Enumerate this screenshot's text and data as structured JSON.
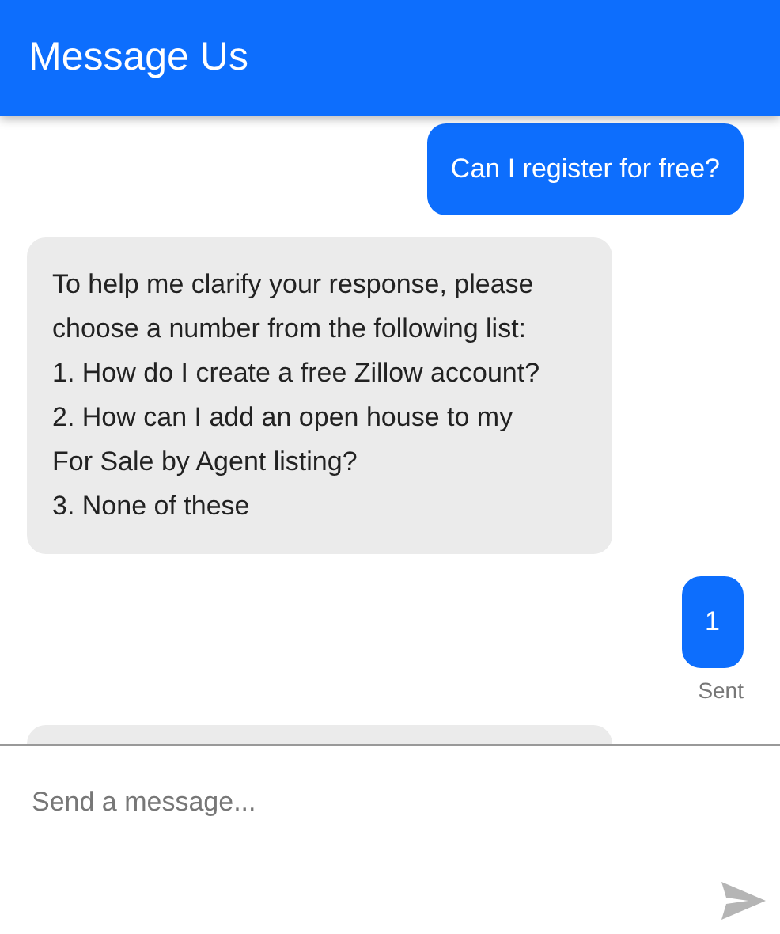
{
  "header": {
    "title": "Message Us"
  },
  "messages": [
    {
      "kind": "user",
      "text": "Can I register for free?"
    },
    {
      "kind": "bot",
      "lines": [
        "To help me clarify your response, please choose a number from the following list:",
        "1. How do I create a free Zillow account?",
        "2. How can I add an open house to my For Sale by Agent listing?",
        "3. None of these"
      ]
    },
    {
      "kind": "user",
      "text": "1",
      "status": "Sent"
    },
    {
      "kind": "bot"
    }
  ],
  "composer": {
    "placeholder": "Send a message..."
  }
}
